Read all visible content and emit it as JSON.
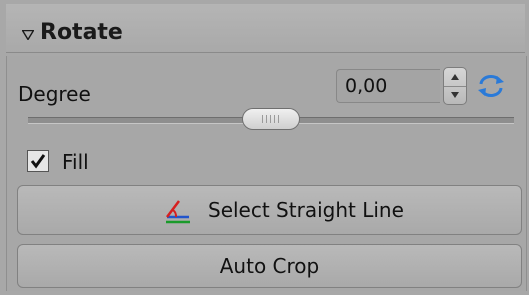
{
  "section": {
    "title": "Rotate"
  },
  "degree": {
    "label": "Degree",
    "value": "0,00",
    "slider_level": 0.5
  },
  "fill": {
    "label": "Fill",
    "checked": true
  },
  "buttons": {
    "select_straight_line": "Select Straight Line",
    "auto_crop": "Auto Crop"
  },
  "icons": {
    "collapse": "triangle-down-icon",
    "reset": "refresh-arrows-icon",
    "straight_line": "straight-line-angle-icon"
  },
  "colors": {
    "panel_bg": "#a8a8a8",
    "reset_icon": "#2a7ad8",
    "straight_line_icon_red": "#d62020",
    "straight_line_icon_green": "#1a9a2a",
    "straight_line_icon_blue": "#2255cc"
  }
}
